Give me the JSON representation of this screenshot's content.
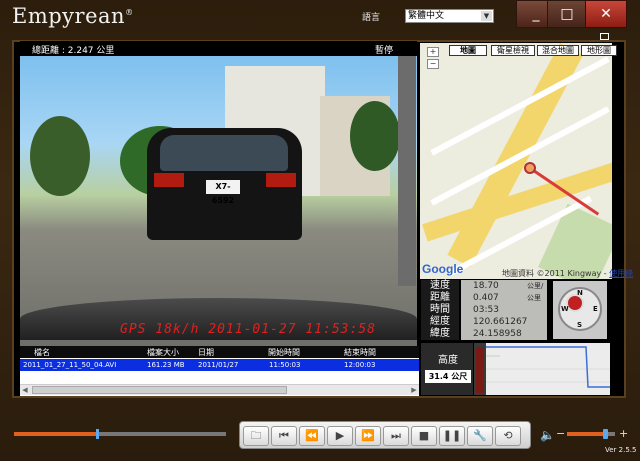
{
  "app": {
    "brand": "Empyrean",
    "trademark": "®",
    "language_label": "語言",
    "language_value": "繁體中文",
    "minimize_label": "_",
    "maximize_label": "□",
    "close_label": "✕",
    "version": "Ver 2.5.5"
  },
  "video": {
    "distance_label": "總距離 : 2.247 公里",
    "status_label": "暫停",
    "plate": "X7-6592",
    "overlay": "GPS  18k/h  2011-01-27  11:53:58"
  },
  "map": {
    "tabs": [
      "地圖",
      "衛星檢視",
      "混合地圖",
      "地形圖"
    ],
    "active_tab": "地圖",
    "zoom_in": "+",
    "zoom_out": "−",
    "logo": "Google",
    "copyright": "地圖資料 ©2011 Kingway -",
    "terms": "使用條款"
  },
  "telemetry": [
    {
      "label": "速度",
      "value": "18.70",
      "unit": "公里/小時"
    },
    {
      "label": "距離",
      "value": "0.407",
      "unit": "公里"
    },
    {
      "label": "時間",
      "value": "03:53",
      "unit": ""
    },
    {
      "label": "經度",
      "value": "120.661267",
      "unit": ""
    },
    {
      "label": "緯度",
      "value": "24.158958",
      "unit": ""
    }
  ],
  "compass": {
    "n": "N",
    "s": "S",
    "e": "E",
    "w": "W"
  },
  "files": {
    "headers": [
      "檔名",
      "檔案大小",
      "日期",
      "開始時間",
      "結束時間"
    ],
    "rows": [
      {
        "name": "2011_01_27_11_50_04.AVI",
        "size": "161.23 MB",
        "date": "2011/01/27",
        "start": "11:50:03",
        "end": "12:00:03"
      }
    ]
  },
  "altitude": {
    "label": "高度",
    "value": "31.4 公尺"
  },
  "player": {
    "progress": 0.39,
    "volume": 0.8,
    "buttons": [
      "open-folder",
      "skip-to-start",
      "rewind",
      "play",
      "fast-forward",
      "skip-to-end",
      "stop",
      "pause",
      "settings",
      "repeat"
    ],
    "volume_minus": "−",
    "volume_plus": "+"
  },
  "colors": {
    "accent": "#e06020",
    "selected_row": "#0a2ee0",
    "overlay_text": "#e02020",
    "route": "#d93a3a"
  }
}
